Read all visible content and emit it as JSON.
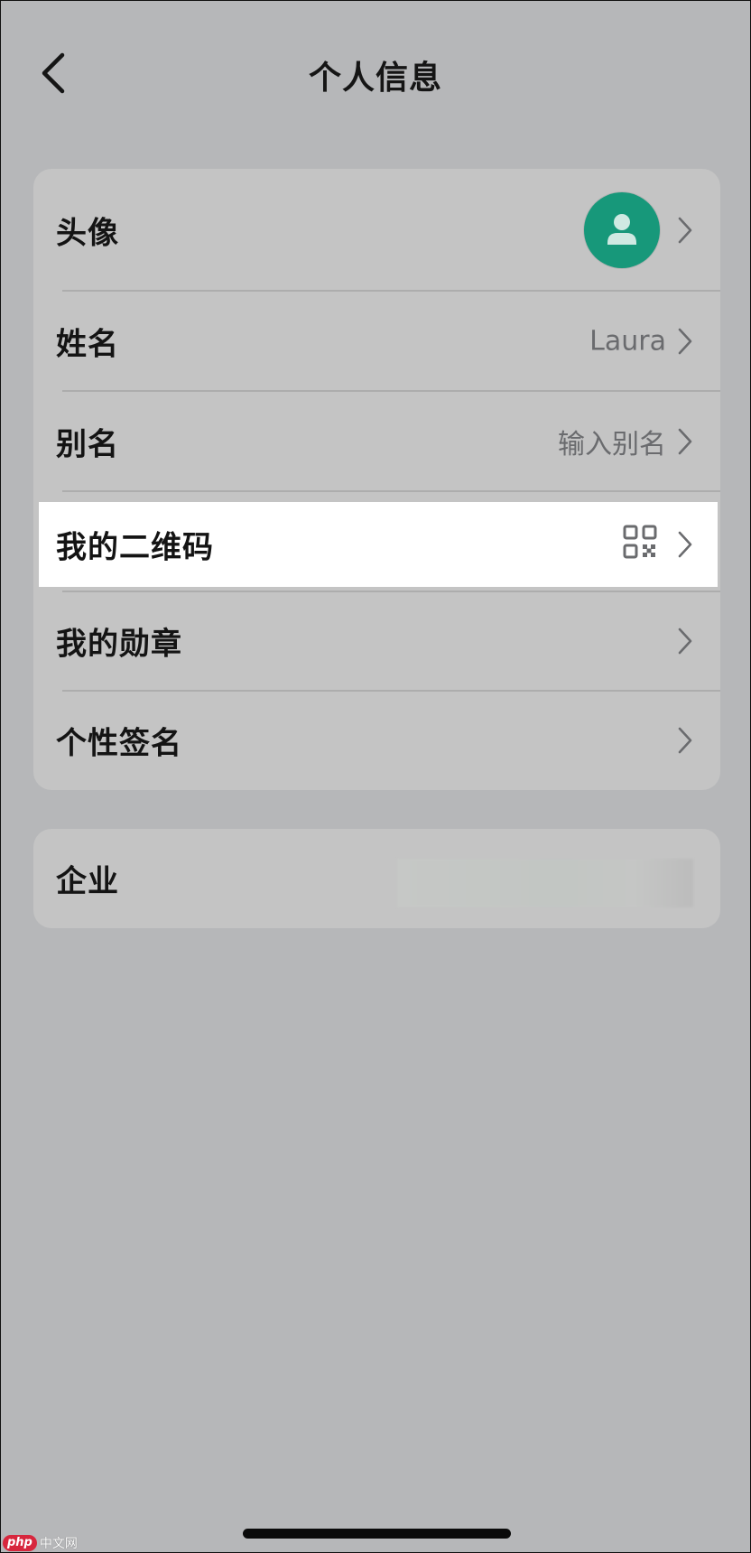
{
  "header": {
    "title": "个人信息"
  },
  "profile": {
    "rows": [
      {
        "label": "头像"
      },
      {
        "label": "姓名",
        "value": "Laura"
      },
      {
        "label": "别名",
        "placeholder": "输入别名"
      },
      {
        "label": "我的二维码"
      },
      {
        "label": "我的勋章"
      },
      {
        "label": "个性签名"
      }
    ]
  },
  "company": {
    "label": "企业"
  },
  "watermark": {
    "logo": "php",
    "text": "中文网"
  },
  "colors": {
    "background": "#b6b7b9",
    "card": "#c4c4c4",
    "avatar": "#17987a",
    "highlight": "#ffffff",
    "value_text": "#6a6b6e"
  },
  "icons": {
    "back": "chevron-left-icon",
    "avatar": "user-icon",
    "qr": "qr-code-icon",
    "row_arrow": "chevron-right-icon"
  }
}
